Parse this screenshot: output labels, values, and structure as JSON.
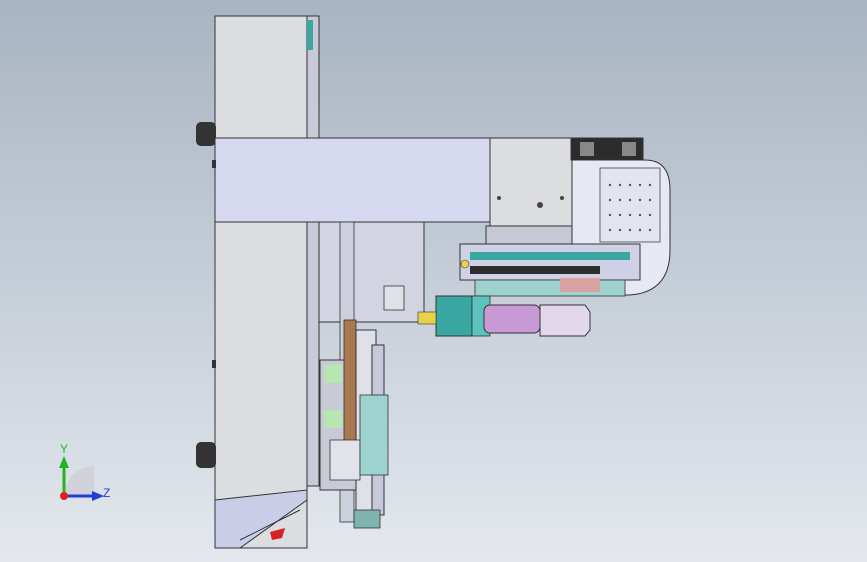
{
  "viewport": {
    "background_top": "#a9b4c2",
    "background_bottom": "#e4e8ee"
  },
  "triad": {
    "y_label": "Y",
    "z_label": "Z",
    "y_color": "#22b422",
    "z_color": "#1f3fd6",
    "x_color": "#e0201a"
  },
  "model": {
    "body_color": "#dcdde0",
    "arm_color": "#d5d8ef",
    "outline_color": "#333333",
    "accent_teal": "#3aa7a3",
    "accent_purple": "#c79ad6",
    "accent_green": "#b7e6b0",
    "accent_red": "#d82020"
  }
}
